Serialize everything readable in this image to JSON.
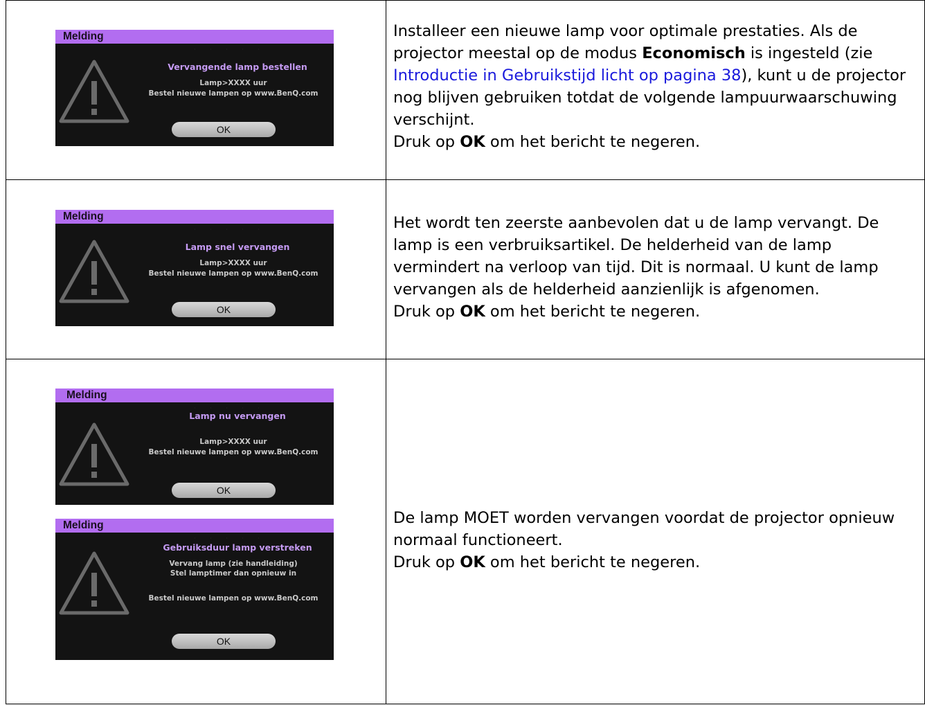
{
  "rows": [
    {
      "dialog": {
        "header": "Melding",
        "title": "Vervangende lamp bestellen",
        "line1": "Lamp>XXXX uur",
        "line2": "Bestel nieuwe lampen op www.BenQ.com",
        "ok": "OK"
      },
      "text": {
        "p1": "Installeer een nieuwe lamp voor optimale prestaties. Als de projector meestal op de modus ",
        "bold": "Economisch",
        "p2": " is ingesteld (zie ",
        "link": "Introductie in Gebruikstijd licht op pagina 38",
        "p3": "), kunt u de projector nog blijven gebruiken totdat de volgende lampuurwaarschuwing verschijnt.",
        "l2a": "Druk op ",
        "l2b": "OK",
        "l2c": " om het bericht te negeren."
      }
    },
    {
      "dialog": {
        "header": "Melding",
        "title": "Lamp snel vervangen",
        "line1": "Lamp>XXXX uur",
        "line2": "Bestel nieuwe lampen op www.BenQ.com",
        "ok": "OK"
      },
      "text": {
        "p1": "Het wordt ten zeerste aanbevolen dat u de lamp vervangt. De lamp is een verbruiksartikel. De helderheid van de lamp vermindert na verloop van tijd. Dit is normaal. U kunt de lamp vervangen als de helderheid aanzienlijk is afgenomen.",
        "l2a": "Druk op ",
        "l2b": "OK",
        "l2c": " om het bericht te negeren."
      }
    },
    {
      "dialogA": {
        "header": "Melding",
        "title": "Lamp nu vervangen",
        "line1": "Lamp>XXXX uur",
        "line2": "Bestel nieuwe lampen op www.BenQ.com",
        "ok": "OK"
      },
      "dialogB": {
        "header": "Melding",
        "title": "Gebruiksduur lamp verstreken",
        "line1": "Vervang lamp (zie handleiding)",
        "line2": "Stel lamptimer dan opnieuw in",
        "line3": "Bestel nieuwe lampen op www.BenQ.com",
        "ok": "OK"
      },
      "text": {
        "p1": "De lamp MOET worden vervangen voordat de projector opnieuw normaal functioneert.",
        "l2a": "Druk op ",
        "l2b": "OK",
        "l2c": " om het bericht te negeren."
      }
    }
  ],
  "colors": {
    "header_bar": "#b26df0",
    "title_text": "#c49af2",
    "dialog_bg": "#131313",
    "link": "#1a1adc"
  },
  "icons": {
    "warning": "warning-triangle-icon"
  }
}
